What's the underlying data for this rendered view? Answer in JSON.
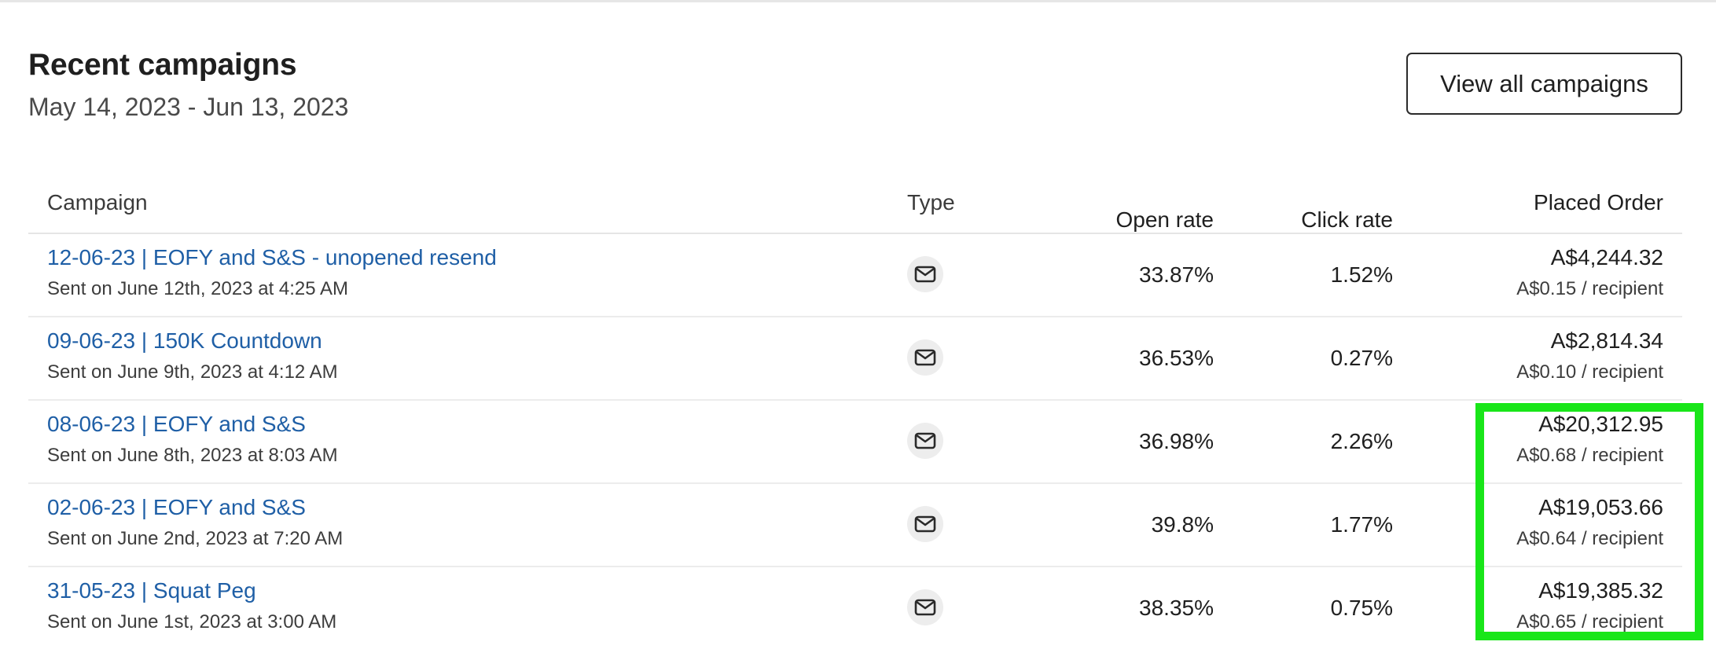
{
  "header": {
    "title": "Recent campaigns",
    "date_range": "May 14, 2023 - Jun 13, 2023",
    "view_all_label": "View all campaigns"
  },
  "table": {
    "columns": [
      "Campaign",
      "Type",
      "Open rate",
      "Click rate",
      "Placed Order"
    ],
    "rows": [
      {
        "name": "12-06-23 | EOFY and S&S - unopened resend",
        "sent": "Sent on June 12th, 2023 at 4:25 AM",
        "type_icon": "mail-icon",
        "open_rate": "33.87%",
        "click_rate": "1.52%",
        "placed_order": "A$4,244.32",
        "per_recipient": "A$0.15 / recipient"
      },
      {
        "name": "09-06-23 | 150K Countdown",
        "sent": "Sent on June 9th, 2023 at 4:12 AM",
        "type_icon": "mail-icon",
        "open_rate": "36.53%",
        "click_rate": "0.27%",
        "placed_order": "A$2,814.34",
        "per_recipient": "A$0.10 / recipient"
      },
      {
        "name": "08-06-23 | EOFY and S&S",
        "sent": "Sent on June 8th, 2023 at 8:03 AM",
        "type_icon": "mail-icon",
        "open_rate": "36.98%",
        "click_rate": "2.26%",
        "placed_order": "A$20,312.95",
        "per_recipient": "A$0.68 / recipient"
      },
      {
        "name": "02-06-23 | EOFY and S&S",
        "sent": "Sent on June 2nd, 2023 at 7:20 AM",
        "type_icon": "mail-icon",
        "open_rate": "39.8%",
        "click_rate": "1.77%",
        "placed_order": "A$19,053.66",
        "per_recipient": "A$0.64 / recipient"
      },
      {
        "name": "31-05-23 | Squat Peg",
        "sent": "Sent on June 1st, 2023 at 3:00 AM",
        "type_icon": "mail-icon",
        "open_rate": "38.35%",
        "click_rate": "0.75%",
        "placed_order": "A$19,385.32",
        "per_recipient": "A$0.65 / recipient"
      }
    ]
  },
  "colors": {
    "link": "#1f5fa6",
    "highlight": "#19e619",
    "icon_badge_bg": "#ededed"
  }
}
